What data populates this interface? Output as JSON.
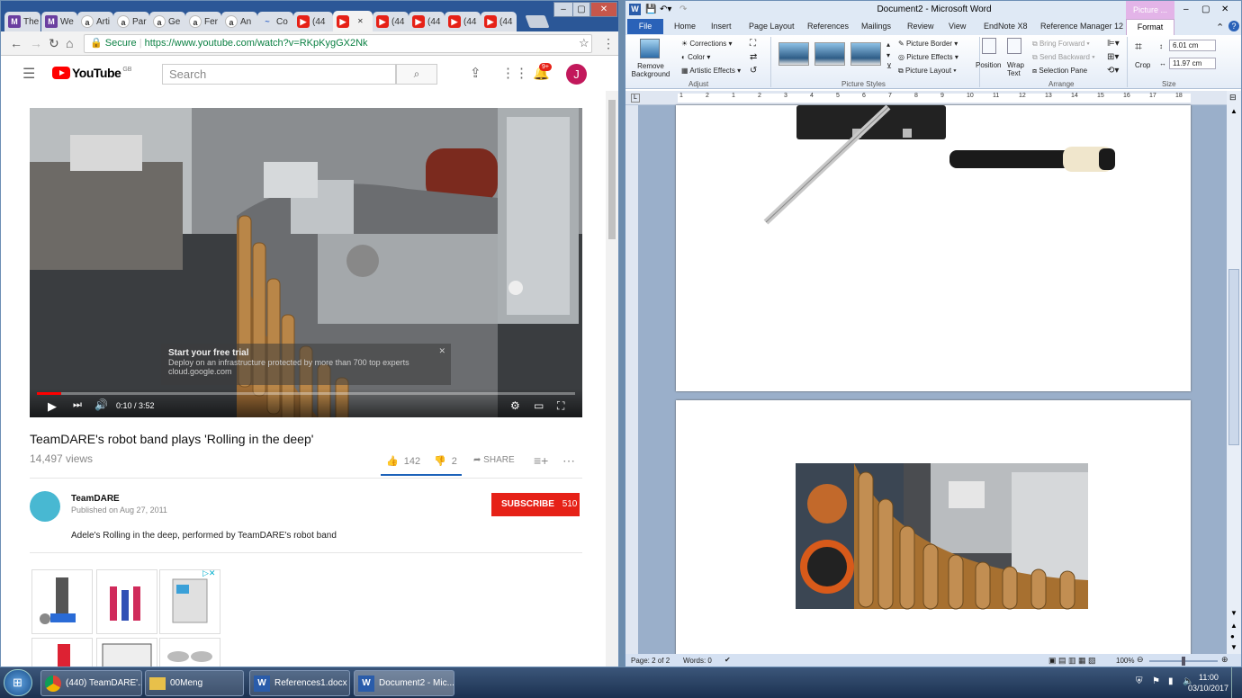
{
  "chrome": {
    "tabs": [
      {
        "icon": "M",
        "type": "m",
        "label": "The"
      },
      {
        "icon": "M",
        "type": "m",
        "label": "We"
      },
      {
        "icon": "a",
        "type": "a",
        "label": "Arti"
      },
      {
        "icon": "a",
        "type": "a",
        "label": "Par"
      },
      {
        "icon": "a",
        "type": "a",
        "label": "Ge"
      },
      {
        "icon": "a",
        "type": "a",
        "label": "Fer"
      },
      {
        "icon": "a",
        "type": "a",
        "label": "An"
      },
      {
        "icon": "~",
        "type": "c",
        "label": "Co"
      },
      {
        "icon": "▶",
        "type": "y",
        "label": "(44"
      },
      {
        "icon": "▶",
        "type": "y",
        "label": "",
        "active": true
      },
      {
        "icon": "▶",
        "type": "y",
        "label": "(44"
      },
      {
        "icon": "▶",
        "type": "y",
        "label": "(44"
      },
      {
        "icon": "▶",
        "type": "y",
        "label": "(44"
      },
      {
        "icon": "▶",
        "type": "y",
        "label": "(44"
      }
    ],
    "secure_label": "Secure",
    "url": "https://www.youtube.com/watch?v=RKpKygGX2Nk"
  },
  "youtube": {
    "logo": "YouTube",
    "region": "GB",
    "search_placeholder": "Search",
    "notif_count": "9+",
    "avatar_letter": "J",
    "ad_title": "Start your free trial",
    "ad_text": "Deploy on an infrastructure protected by more than 700 top experts",
    "ad_url": "cloud.google.com",
    "time": "0:10 / 3:52",
    "progress": 0.045,
    "video_title": "TeamDARE's robot band plays 'Rolling in the deep'",
    "views": "14,497 views",
    "likes": "142",
    "dislikes": "2",
    "share": "SHARE",
    "channel": "TeamDARE",
    "published": "Published on Aug 27, 2011",
    "subscribe": "SUBSCRIBE",
    "subscribers": "510",
    "description": "Adele's Rolling in the deep, performed by TeamDARE's robot band"
  },
  "word": {
    "title": "Document2 - Microsoft Word",
    "context_tab": "Picture ...",
    "tabs": [
      "File",
      "Home",
      "Insert",
      "Page Layout",
      "References",
      "Mailings",
      "Review",
      "View",
      "EndNote X8",
      "Reference Manager 12",
      "Format"
    ],
    "ribbon": {
      "remove_bg": "Remove Background",
      "corrections": "Corrections",
      "color": "Color",
      "artistic": "Artistic Effects",
      "adjust": "Adjust",
      "picture_styles": "Picture Styles",
      "picture_border": "Picture Border",
      "picture_effects": "Picture Effects",
      "picture_layout": "Picture Layout",
      "position": "Position",
      "wrap_text": "Wrap Text",
      "bring_forward": "Bring Forward",
      "send_backward": "Send Backward",
      "selection_pane": "Selection Pane",
      "arrange": "Arrange",
      "crop": "Crop",
      "height": "6.01 cm",
      "width": "11.97 cm",
      "size": "Size"
    },
    "ruler_marks": [
      "1",
      "2",
      "1",
      "2",
      "3",
      "4",
      "5",
      "6",
      "7",
      "8",
      "9",
      "10",
      "11",
      "12",
      "13",
      "14",
      "15",
      "16",
      "17",
      "18"
    ],
    "status_page": "Page: 2 of 2",
    "status_words": "Words: 0",
    "zoom": "100%"
  },
  "taskbar": {
    "items": [
      "(440) TeamDARE'...",
      "00Meng",
      "References1.docx ...",
      "Document2 - Mic..."
    ],
    "time": "11:00",
    "date": "03/10/2017"
  }
}
